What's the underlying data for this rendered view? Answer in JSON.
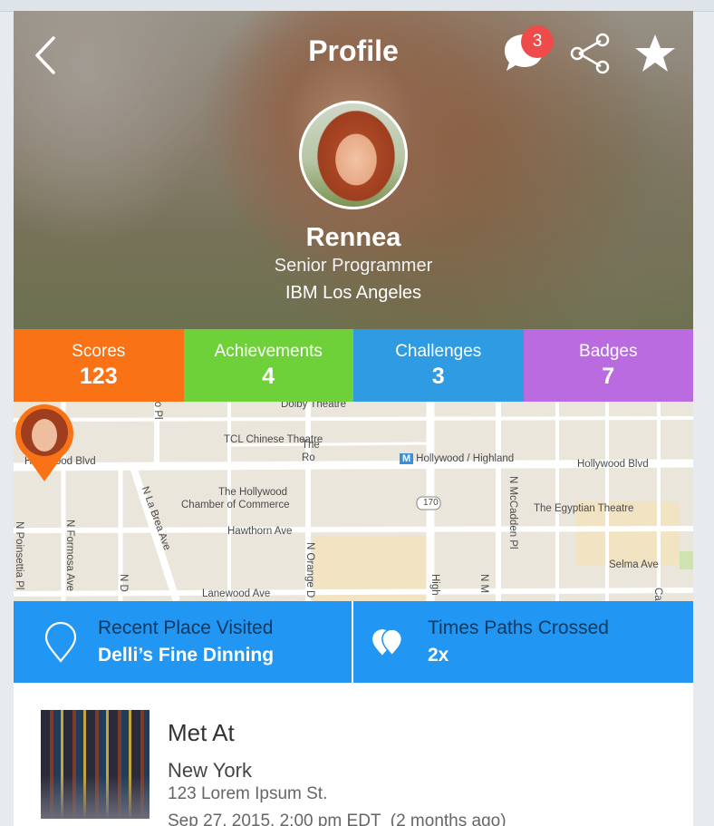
{
  "header": {
    "title": "Profile",
    "notification_count": "3",
    "icons": [
      "back-icon",
      "chat-icon",
      "share-icon",
      "star-icon"
    ]
  },
  "profile": {
    "name": "Rennea",
    "job_title": "Senior Programmer",
    "company": "IBM Los Angeles"
  },
  "stats": [
    {
      "label": "Scores",
      "value": "123",
      "color": "#f97316"
    },
    {
      "label": "Achievements",
      "value": "4",
      "color": "#6fd13a"
    },
    {
      "label": "Challenges",
      "value": "3",
      "color": "#2f9be3"
    },
    {
      "label": "Badges",
      "value": "7",
      "color": "#b96bdf"
    }
  ],
  "map": {
    "labels": {
      "dolby": "Dolby Theatre",
      "tcl": "TCL Chinese Theatre",
      "hollywood_highland": "Hollywood / Highland",
      "metro": "M",
      "hollywood_blvd_left": "Hollywood Blvd",
      "hollywood_blvd_right": "Hollywood Blvd",
      "chamber1": "The Hollywood",
      "chamber2": "Chamber of Commerce",
      "the_ro1": "The",
      "the_ro2": "Ro",
      "egyptian": "The Egyptian Theatre",
      "hawthorn": "Hawthorn Ave",
      "lanewood": "Lanewood Ave",
      "selma": "Selma Ave",
      "route": "170",
      "orchid": "ito Pl",
      "la_brea": "N La Brea Ave",
      "formosa": "N Formosa Ave",
      "poinsettia": "N Poinsettia Pl",
      "orange": "N Orange D",
      "mccadden": "N McCadden Pl",
      "highland": "High",
      "nd": "N D",
      "nm": "N M",
      "ca": "Ca"
    },
    "pin_color": "#f97316"
  },
  "info": {
    "recent_place_label": "Recent Place Visited",
    "recent_place_value": "Delli’s Fine Dinning",
    "paths_label": "Times Paths Crossed",
    "paths_value": "2x"
  },
  "met_at": {
    "title": "Met At",
    "city": "New York",
    "address": "123 Lorem Ipsum St.",
    "date": "Sep 27, 2015. 2:00 pm EDT  (2 months ago)"
  }
}
